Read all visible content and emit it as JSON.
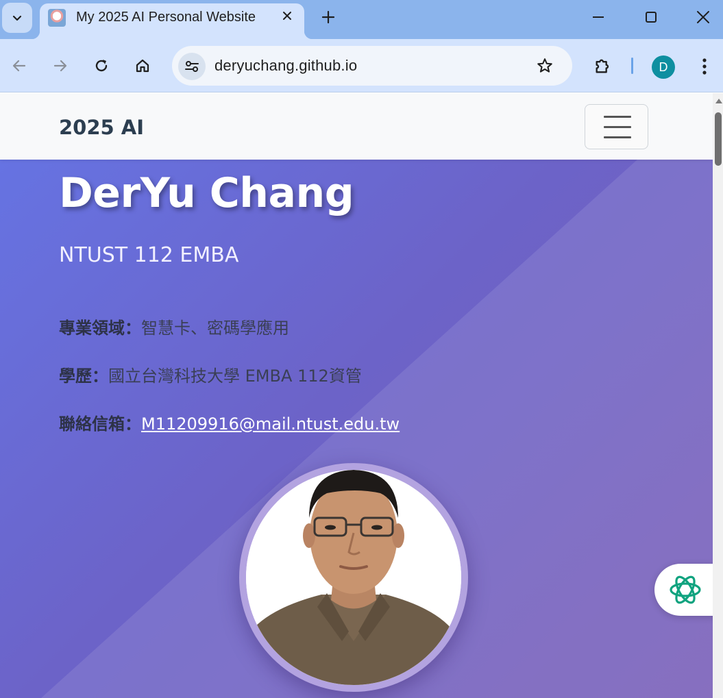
{
  "browser": {
    "tab_title": "My 2025 AI Personal Website",
    "url": "deryuchang.github.io",
    "profile_initial": "D"
  },
  "site": {
    "brand": "2025 AI",
    "hero": {
      "name": "DerYu Chang",
      "subtitle": "NTUST 112 EMBA",
      "fields": [
        {
          "label": "專業領域：",
          "value": "智慧卡、密碼學應用"
        },
        {
          "label": "學歷：",
          "value": "國立台灣科技大學 EMBA 112資管"
        },
        {
          "label": "聯絡信箱：",
          "value": "M11209916@mail.ntust.edu.tw"
        }
      ]
    }
  },
  "colors": {
    "hero_gradient_start": "#6673e2",
    "hero_gradient_end": "#7a5fb8",
    "brand_text": "#2c3e50",
    "tab_strip": "#8bb4ec",
    "toolbar": "#d3e3fd",
    "floating_button_icon": "#10a37f"
  }
}
